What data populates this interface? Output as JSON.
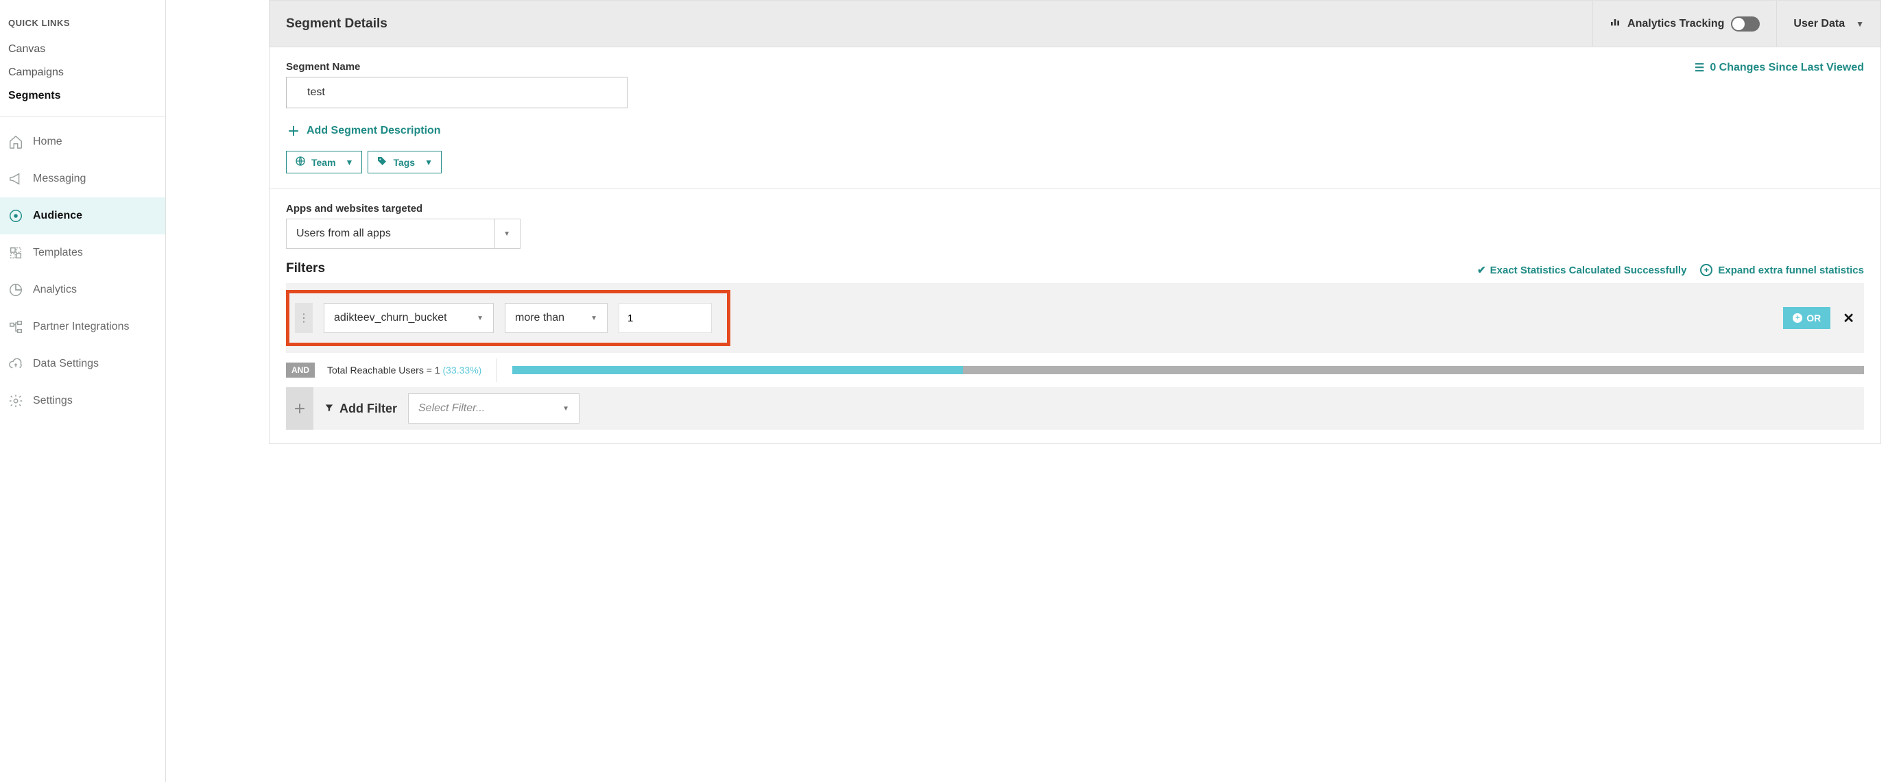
{
  "sidebar": {
    "quick_links_heading": "QUICK LINKS",
    "quick_links": [
      {
        "label": "Canvas",
        "active": false
      },
      {
        "label": "Campaigns",
        "active": false
      },
      {
        "label": "Segments",
        "active": true
      }
    ],
    "nav": [
      {
        "label": "Home",
        "icon": "home-icon",
        "active": false
      },
      {
        "label": "Messaging",
        "icon": "megaphone-icon",
        "active": false
      },
      {
        "label": "Audience",
        "icon": "target-icon",
        "active": true
      },
      {
        "label": "Templates",
        "icon": "template-icon",
        "active": false
      },
      {
        "label": "Analytics",
        "icon": "piechart-icon",
        "active": false
      },
      {
        "label": "Partner Integrations",
        "icon": "integrations-icon",
        "active": false
      },
      {
        "label": "Data Settings",
        "icon": "cloud-refresh-icon",
        "active": false
      },
      {
        "label": "Settings",
        "icon": "gear-icon",
        "active": false
      }
    ]
  },
  "header": {
    "title": "Segment Details",
    "analytics_tracking_label": "Analytics Tracking",
    "analytics_tracking_on": false,
    "user_data_label": "User Data"
  },
  "segment": {
    "name_label": "Segment Name",
    "name_value": "test",
    "changes_link": "0 Changes Since Last Viewed",
    "add_description_label": "Add Segment Description",
    "team_label": "Team",
    "tags_label": "Tags"
  },
  "targeting": {
    "apps_label": "Apps and websites targeted",
    "apps_value": "Users from all apps"
  },
  "filters": {
    "heading": "Filters",
    "status_ok": "Exact Statistics Calculated Successfully",
    "expand_label": "Expand extra funnel statistics",
    "row": {
      "attribute": "adikteev_churn_bucket",
      "operator": "more than",
      "value": "1"
    },
    "or_label": "OR",
    "and_label": "AND",
    "reachable_prefix": "Total Reachable Users = ",
    "reachable_count": "1",
    "reachable_pct": "(33.33%)",
    "reachable_pct_value": 33.33,
    "add_filter_label": "Add Filter",
    "select_filter_placeholder": "Select Filter..."
  }
}
